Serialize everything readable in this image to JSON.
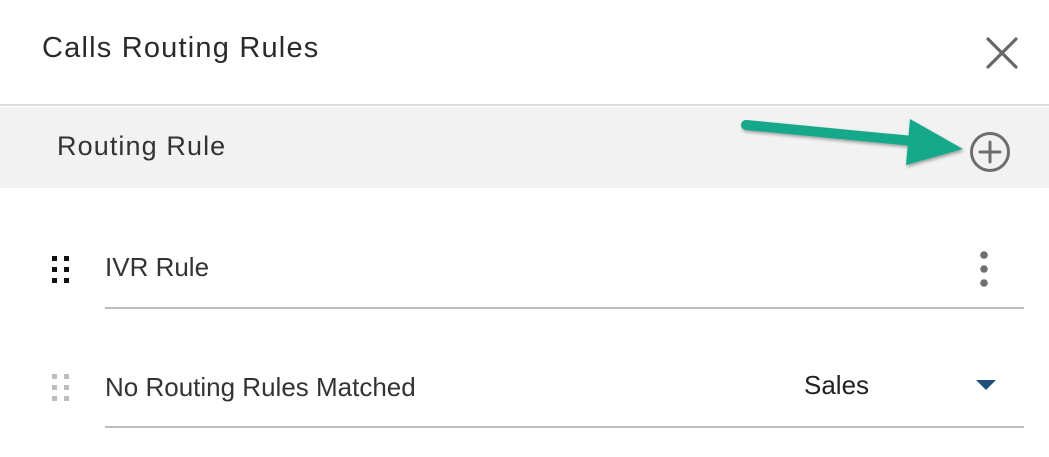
{
  "dialog": {
    "title": "Calls Routing Rules"
  },
  "section": {
    "title": "Routing Rule"
  },
  "rules": [
    {
      "label": "IVR Rule"
    },
    {
      "label": "No Routing Rules Matched",
      "selected_value": "Sales"
    }
  ],
  "icons": {
    "close": "close-icon",
    "add": "add-circle-icon",
    "drag": "drag-handle-icon",
    "more": "more-vert-icon",
    "dropdown": "caret-down-icon",
    "callout": "arrow-callout"
  },
  "colors": {
    "callout_arrow": "#14a88a",
    "caret": "#1d4f7a",
    "icon_gray": "#6e6e6e"
  }
}
